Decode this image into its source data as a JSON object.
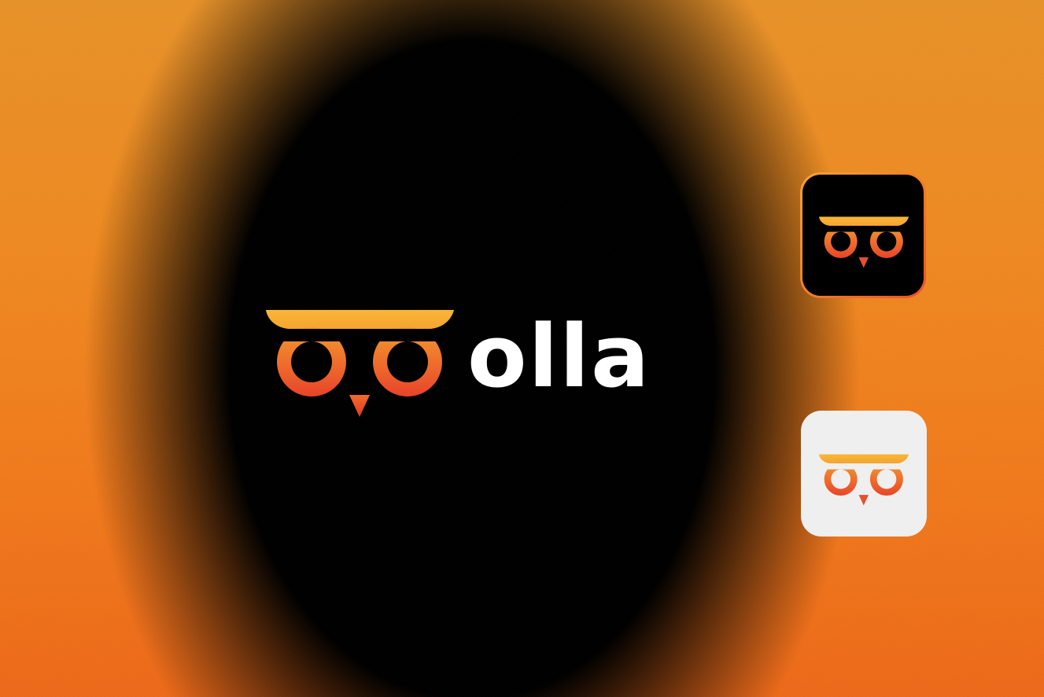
{
  "brand": {
    "name": "olla",
    "colors": {
      "orange_light": "#f7ad33",
      "orange_mid": "#f07e2a",
      "orange_dark": "#e8442a",
      "background": "#000000",
      "wordmark": "#ffffff",
      "light_tile": "#efefef"
    }
  },
  "icons": {
    "main_logo": "owl-logo-icon",
    "dark_app_icon": "owl-app-icon-dark",
    "light_app_icon": "owl-app-icon-light"
  }
}
